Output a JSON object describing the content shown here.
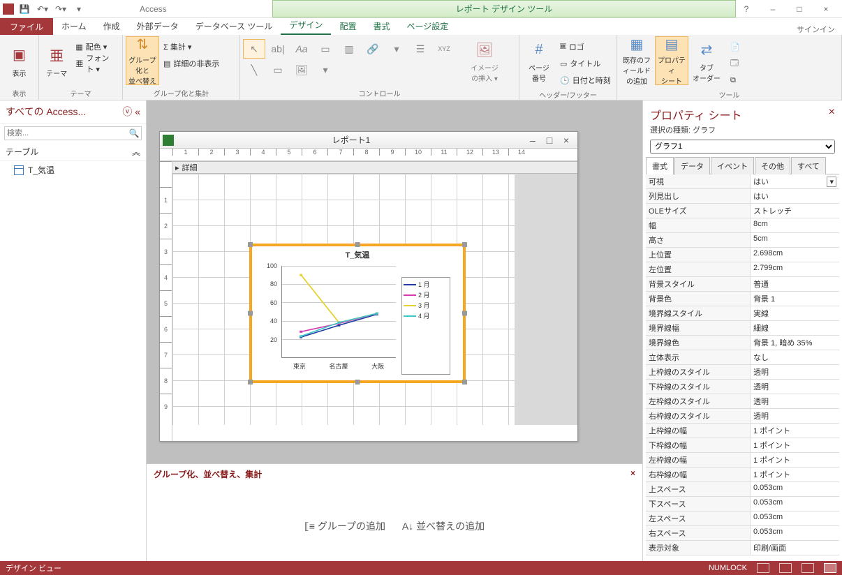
{
  "app_title": "Access",
  "tool_tab_title": "レポート デザイン ツール",
  "window_buttons": {
    "help": "?",
    "min": "–",
    "max": "□",
    "close": "×"
  },
  "signin": "サインイン",
  "tabs": {
    "file": "ファイル",
    "home": "ホーム",
    "create": "作成",
    "external": "外部データ",
    "dbtools": "データベース ツール",
    "design": "デザイン",
    "arrange": "配置",
    "format": "書式",
    "pagesetup": "ページ設定"
  },
  "ribbon_groups": {
    "view": {
      "label": "表示",
      "btn": "表示"
    },
    "theme": {
      "label": "テーマ",
      "btn": "テーマ",
      "colors": "配色 ▾",
      "fonts": "フォント ▾"
    },
    "grouping": {
      "label": "グループ化と集計",
      "btn": "グループ化と\n並べ替え",
      "totals": "Σ 集計 ▾",
      "hide": "詳細の非表示"
    },
    "controls": {
      "label": "コントロール",
      "image": "イメージ\nの挿入 ▾"
    },
    "hdrftr": {
      "label": "ヘッダー/フッター",
      "page": "ページ\n番号",
      "logo": "ロゴ",
      "title": "タイトル",
      "datetime": "日付と時刻"
    },
    "tools": {
      "label": "ツール",
      "addfield": "既存のフィールド\nの追加",
      "propsheet": "プロパティ\nシート",
      "taborder": "タブ\nオーダー"
    }
  },
  "nav": {
    "header": "すべての Access...",
    "search_ph": "検索...",
    "section": "テーブル",
    "item": "T_気温"
  },
  "doc": {
    "title": "レポート1",
    "section": "詳細"
  },
  "bottom": {
    "title": "グループ化、並べ替え、集計",
    "add_group": "グループの追加",
    "add_sort": "並べ替えの追加"
  },
  "propsheet": {
    "title": "プロパティ シート",
    "subtitle": "選択の種類: グラフ",
    "selector": "グラフ1",
    "tabs": {
      "format": "書式",
      "data": "データ",
      "event": "イベント",
      "other": "その他",
      "all": "すべて"
    },
    "rows": [
      {
        "k": "可視",
        "v": "はい"
      },
      {
        "k": "列見出し",
        "v": "はい"
      },
      {
        "k": "OLEサイズ",
        "v": "ストレッチ"
      },
      {
        "k": "幅",
        "v": "8cm"
      },
      {
        "k": "高さ",
        "v": "5cm"
      },
      {
        "k": "上位置",
        "v": "2.698cm"
      },
      {
        "k": "左位置",
        "v": "2.799cm"
      },
      {
        "k": "背景スタイル",
        "v": "普通"
      },
      {
        "k": "背景色",
        "v": "背景 1"
      },
      {
        "k": "境界線スタイル",
        "v": "実線"
      },
      {
        "k": "境界線幅",
        "v": "細線"
      },
      {
        "k": "境界線色",
        "v": "背景 1, 暗め 35%"
      },
      {
        "k": "立体表示",
        "v": "なし"
      },
      {
        "k": "上枠線のスタイル",
        "v": "透明"
      },
      {
        "k": "下枠線のスタイル",
        "v": "透明"
      },
      {
        "k": "左枠線のスタイル",
        "v": "透明"
      },
      {
        "k": "右枠線のスタイル",
        "v": "透明"
      },
      {
        "k": "上枠線の幅",
        "v": "1 ポイント"
      },
      {
        "k": "下枠線の幅",
        "v": "1 ポイント"
      },
      {
        "k": "左枠線の幅",
        "v": "1 ポイント"
      },
      {
        "k": "右枠線の幅",
        "v": "1 ポイント"
      },
      {
        "k": "上スペース",
        "v": "0.053cm"
      },
      {
        "k": "下スペース",
        "v": "0.053cm"
      },
      {
        "k": "左スペース",
        "v": "0.053cm"
      },
      {
        "k": "右スペース",
        "v": "0.053cm"
      },
      {
        "k": "表示対象",
        "v": "印刷/画面"
      }
    ]
  },
  "status": {
    "left": "デザイン ビュー",
    "numlock": "NUMLOCK"
  },
  "chart_data": {
    "type": "line",
    "title": "T_気温",
    "categories": [
      "東京",
      "名古屋",
      "大阪"
    ],
    "series": [
      {
        "name": "1 月",
        "color": "#1f3ca6",
        "values": [
          22,
          35,
          47
        ]
      },
      {
        "name": "2 月",
        "color": "#d63ab0",
        "values": [
          28,
          37,
          48
        ]
      },
      {
        "name": "3 月",
        "color": "#e6d235",
        "values": [
          90,
          38,
          48
        ]
      },
      {
        "name": "4 月",
        "color": "#3ec6c6",
        "values": [
          23,
          38,
          48
        ]
      }
    ],
    "ylim": [
      0,
      100
    ],
    "yticks": [
      20,
      40,
      60,
      80,
      100
    ]
  }
}
